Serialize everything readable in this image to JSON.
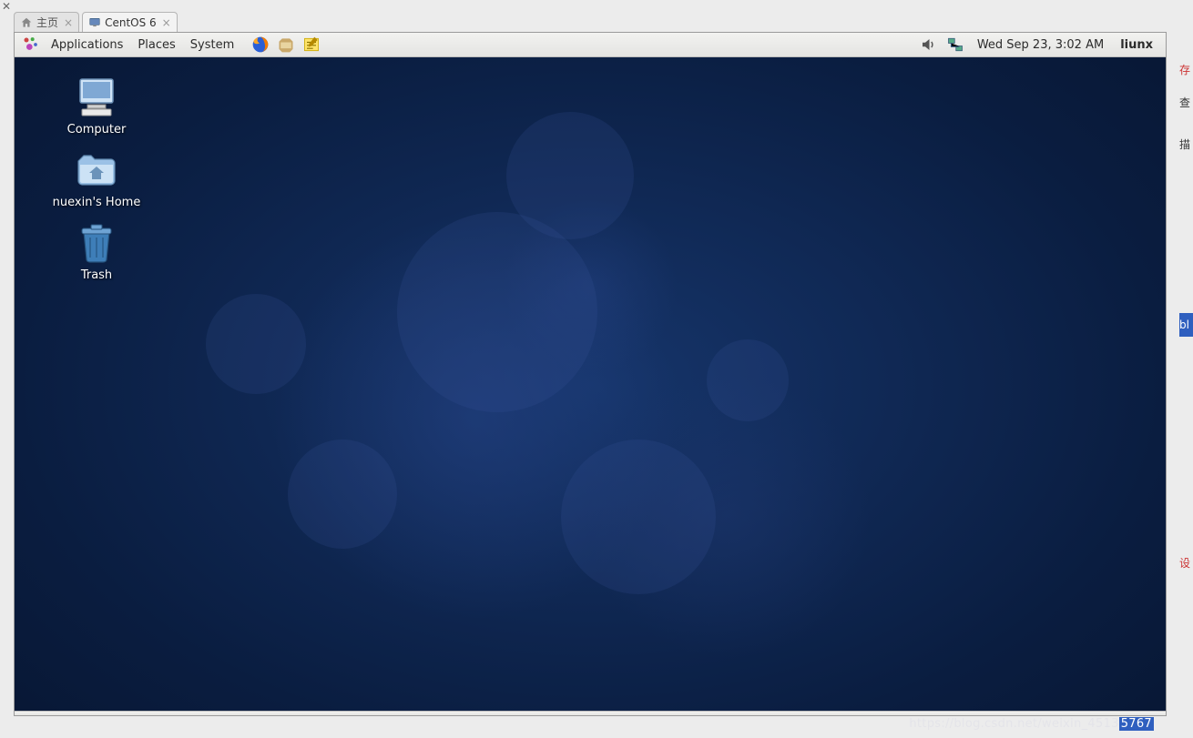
{
  "host": {
    "tabs": [
      {
        "label": "主页",
        "active": false
      },
      {
        "label": "CentOS 6",
        "active": true
      }
    ]
  },
  "panel": {
    "menus": {
      "applications": "Applications",
      "places": "Places",
      "system": "System"
    },
    "datetime": "Wed Sep 23,  3:02 AM",
    "username": "liunx"
  },
  "desktop": {
    "icons": [
      {
        "name": "computer",
        "label": "Computer"
      },
      {
        "name": "home",
        "label": "nuexin's Home"
      },
      {
        "name": "trash",
        "label": "Trash"
      }
    ]
  },
  "watermark": {
    "text_prefix": "https://blog.csdn.net/weixin_4513",
    "text_suffix": "5767"
  },
  "right_fragments": {
    "a": "存",
    "b": "查",
    "c": "描",
    "d": "bl",
    "e": "设"
  }
}
